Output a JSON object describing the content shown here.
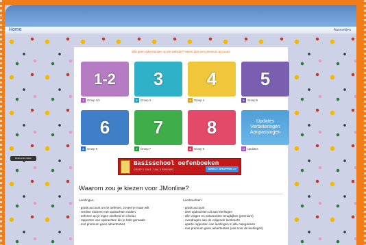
{
  "nav": {
    "home": "Home",
    "login": "Aanmelden"
  },
  "left_badge": "Gratis extra zaken",
  "promo": "Wilt geen advertenties op de website? Neem dan een premium account!",
  "tiles": [
    {
      "number": "1-2",
      "caption": "Groep 1/2",
      "color": "#b57cc3",
      "icon_color": "#b057c0"
    },
    {
      "number": "3",
      "caption": "Groep 3",
      "color": "#2fb1c8",
      "icon_color": "#1fa6c0"
    },
    {
      "number": "4",
      "caption": "Groep 4",
      "color": "#f0c63a",
      "icon_color": "#e0a51b"
    },
    {
      "number": "5",
      "caption": "Groep 5",
      "color": "#7a5fb0",
      "icon_color": "#6b4fa8"
    },
    {
      "number": "6",
      "caption": "Groep 6",
      "color": "#3e7fc8",
      "icon_color": "#2f6fc0"
    },
    {
      "number": "7",
      "caption": "Groep 7",
      "color": "#3fae4a",
      "icon_color": "#2e9a3a"
    },
    {
      "number": "8",
      "caption": "Groep 8",
      "color": "#e34a6a",
      "icon_color": "#d33a5c"
    },
    {
      "number": "",
      "caption": "Updates",
      "color": "#4f9fd8",
      "icon_color": "#9b5bc0",
      "lines": "Updates Verbeteringen Aanpassingen"
    }
  ],
  "banner": {
    "title": "Basisschool oefenboeken",
    "subtitle": "GROEP 1 T/M 8 - TAAL & REKENEN",
    "button": "DIRECT SHOPPEN >>"
  },
  "why_title": "Waarom zou je kiezen voor JMonline?",
  "students": {
    "heading": "Leerlingen:",
    "items": [
      "- gratis account om te oefenen, zoveel je maar wilt",
      "- verdien stickers met opdrachten maken",
      "- oefenen op je eigen snelheid en niveau",
      "- rapporten van opdrachten die je hebt gemaakt",
      "- met premium geen advertenties"
    ]
  },
  "teachers": {
    "heading": "Leerkrachten:",
    "items": [
      "- gratis account",
      "- deel opdrachten uit aan leerlingen",
      "- alle vragen en antwoorden terugkijken (premium)",
      "- overdragen aan de volgende leerkracht",
      "- aparte rapporten van leerlingen in alle categorieën",
      "- met premium geen advertenties (ook voor de leerlingen)"
    ]
  }
}
